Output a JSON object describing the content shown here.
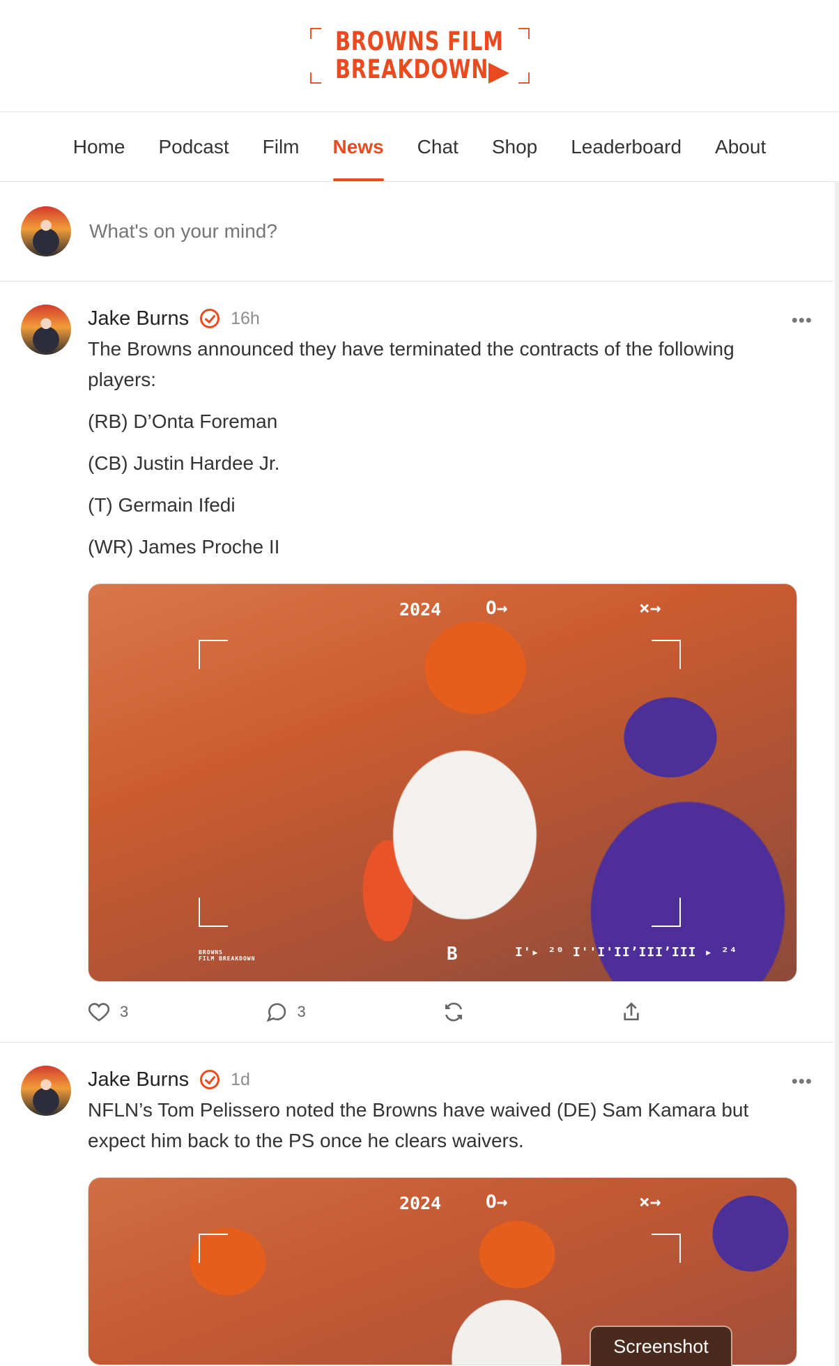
{
  "brand": {
    "line1": "BROWNS FILM",
    "line2": "BREAKDOWN",
    "accent": "#ea4a1e"
  },
  "nav": {
    "items": [
      "Home",
      "Podcast",
      "Film",
      "News",
      "Chat",
      "Shop",
      "Leaderboard",
      "About"
    ],
    "active": "News"
  },
  "composer": {
    "placeholder": "What's on your mind?"
  },
  "posts": [
    {
      "author": "Jake Burns",
      "verified": true,
      "time": "16h",
      "text": "The Browns announced they have terminated the contracts of the following players:",
      "players": [
        "(RB) D’Onta Foreman",
        "(CB) Justin Hardee Jr.",
        "(T) Germain Ifedi",
        "(WR) James Proche II"
      ],
      "image_overlay": {
        "year": "2024",
        "rec": "O→",
        "close": "×→",
        "brand": "BROWNS\nFILM BREAKDOWN",
        "letter": "B",
        "ticks": "I'▸ ²⁰   I''I'IIʼIIIʼIII ▸ ²⁴"
      },
      "likes": "3",
      "comments": "3"
    },
    {
      "author": "Jake Burns",
      "verified": true,
      "time": "1d",
      "text": "NFLN’s Tom Pelissero noted the Browns have waived (DE) Sam Kamara but expect him back to the PS once he clears waivers.",
      "image_overlay": {
        "year": "2024",
        "rec": "O→",
        "close": "×→"
      }
    }
  ],
  "toast": {
    "label": "Screenshot"
  }
}
